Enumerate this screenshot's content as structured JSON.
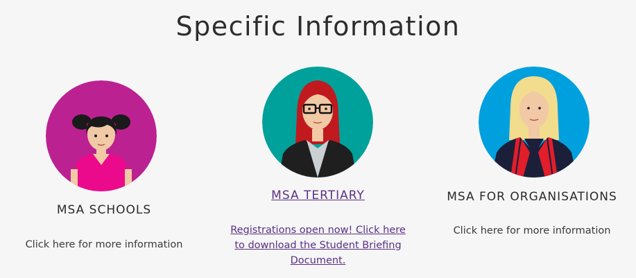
{
  "section": {
    "title": "Specific Information"
  },
  "cards": [
    {
      "title": "MSA SCHOOLS",
      "description": "Click here for more information",
      "avatar_bg": "#bc2191",
      "icon": "schoolgirl-avatar-icon"
    },
    {
      "title": "MSA TERTIARY",
      "description": "Registrations open now! Click here to download the Student Briefing Document.",
      "avatar_bg": "#00a19a",
      "icon": "student-woman-avatar-icon"
    },
    {
      "title": "MSA FOR ORGANISATIONS",
      "description": "Click here for more information",
      "avatar_bg": "#00a0de",
      "icon": "businesswoman-avatar-icon"
    }
  ],
  "colors": {
    "background": "#f6f6f6",
    "link": "#5a2f87",
    "heading": "#2d2d2d"
  }
}
